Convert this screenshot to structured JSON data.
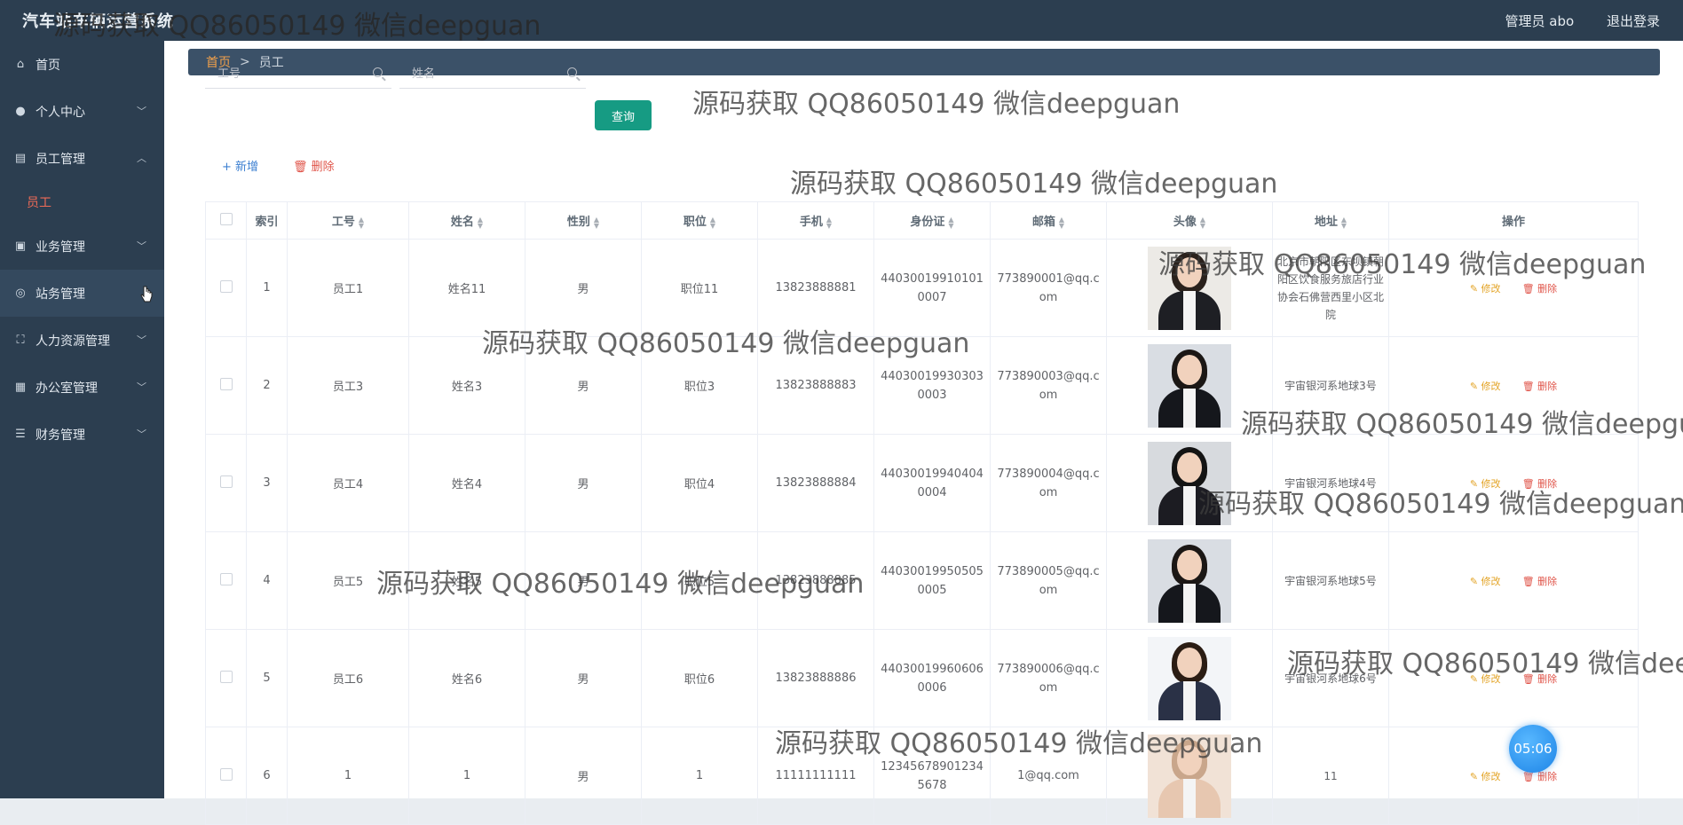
{
  "app": {
    "title": "汽车站车辆运营系统"
  },
  "header": {
    "admin_label": "管理员 abo",
    "logout_label": "退出登录"
  },
  "sidebar": {
    "items": [
      {
        "label": "首页",
        "icon": "home-icon"
      },
      {
        "label": "个人中心",
        "icon": "user-icon"
      },
      {
        "label": "员工管理",
        "icon": "clipboard-icon",
        "expanded": true,
        "children": [
          {
            "label": "员工"
          }
        ]
      },
      {
        "label": "业务管理",
        "icon": "clipboard-check-icon"
      },
      {
        "label": "站务管理",
        "icon": "compass-icon"
      },
      {
        "label": "人力资源管理",
        "icon": "expand-icon"
      },
      {
        "label": "办公室管理",
        "icon": "grid-icon"
      },
      {
        "label": "财务管理",
        "icon": "sliders-icon"
      }
    ]
  },
  "breadcrumb": {
    "home": "首页",
    "sep": ">",
    "current": "员工"
  },
  "search": {
    "id_placeholder": "工号",
    "name_placeholder": "姓名",
    "query_label": "查询"
  },
  "actions": {
    "add_label": "+ 新增",
    "delete_label": "删除"
  },
  "table": {
    "headers": [
      "索引",
      "工号",
      "姓名",
      "性别",
      "职位",
      "手机",
      "身份证",
      "邮箱",
      "头像",
      "地址",
      "操作"
    ],
    "edit_label": "修改",
    "delete_label": "删除",
    "rows": [
      {
        "index": "1",
        "id": "员工1",
        "name": "姓名11",
        "gender": "男",
        "position": "职位11",
        "phone": "13823888881",
        "idcard": "440300199101010007",
        "email": "773890001@qq.com",
        "address": "北京市朝阳区东坝镇朝阳区饮食服务旅店行业协会石佛营西里小区北院"
      },
      {
        "index": "2",
        "id": "员工3",
        "name": "姓名3",
        "gender": "男",
        "position": "职位3",
        "phone": "13823888883",
        "idcard": "440300199303030003",
        "email": "773890003@qq.com",
        "address": "宇宙银河系地球3号"
      },
      {
        "index": "3",
        "id": "员工4",
        "name": "姓名4",
        "gender": "男",
        "position": "职位4",
        "phone": "13823888884",
        "idcard": "440300199404040004",
        "email": "773890004@qq.com",
        "address": "宇宙银河系地球4号"
      },
      {
        "index": "4",
        "id": "员工5",
        "name": "姓名5",
        "gender": "男",
        "position": "职位5",
        "phone": "13823888885",
        "idcard": "440300199505050005",
        "email": "773890005@qq.com",
        "address": "宇宙银河系地球5号"
      },
      {
        "index": "5",
        "id": "员工6",
        "name": "姓名6",
        "gender": "男",
        "position": "职位6",
        "phone": "13823888886",
        "idcard": "440300199606060006",
        "email": "773890006@qq.com",
        "address": "宇宙银河系地球6号"
      },
      {
        "index": "6",
        "id": "1",
        "name": "1",
        "gender": "男",
        "position": "1",
        "phone": "11111111111",
        "idcard": "123456789012345678",
        "email": "1@qq.com",
        "address": "11"
      }
    ]
  },
  "timer": {
    "label": "05:06"
  },
  "watermark": {
    "text": "源码获取 QQ86050149 微信deepguan"
  }
}
